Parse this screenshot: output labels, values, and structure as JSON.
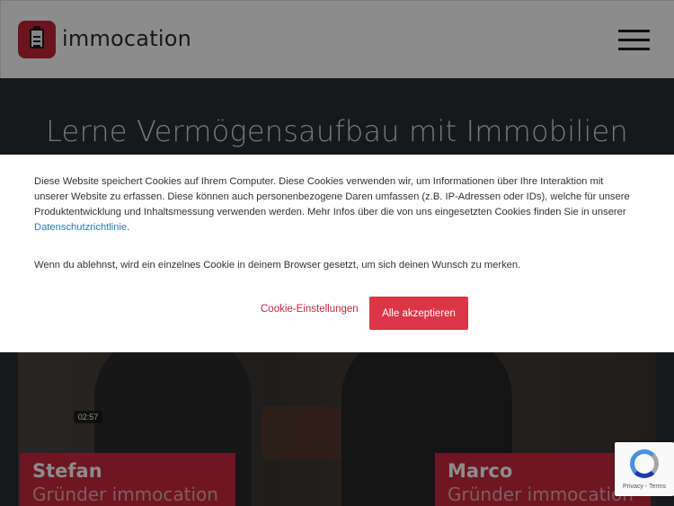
{
  "header": {
    "logo_text": "immocation",
    "menu_icon": "hamburger-icon"
  },
  "hero": {
    "title": "Lerne Vermögensaufbau mit Immobilien"
  },
  "video": {
    "person1_name": "Stefan",
    "person1_role": "Gründer immocation",
    "person2_name": "Marco",
    "person2_role": "Gründer immocation",
    "timestamp": "02:57"
  },
  "cookie": {
    "text1": "Diese Website speichert Cookies auf Ihrem Computer. Diese Cookies verwenden wir, um Informationen über Ihre Interaktion mit unserer Website zu erfassen. Diese können auch personenbezogene Daren umfassen (z.B. IP-Adressen oder IDs), welche für unsere Produktentwicklung und Inhaltsmessung verwenden werden. Mehr Infos über die von uns eingesetzten Cookies finden Sie in unserer ",
    "privacy_link": "Datenschutzrichtlinie",
    "text1_end": ".",
    "text2": "Wenn du ablehnst, wird ein einzelnes Cookie in deinem Browser gesetzt, um sich deinen Wunsch zu merken.",
    "settings_label": "Cookie-Einstellungen",
    "accept_label": "Alle akzeptieren"
  },
  "recaptcha": {
    "footer": "Privacy - Terms"
  },
  "colors": {
    "brand_red": "#c9283c",
    "accept_button": "#dc3545",
    "link_blue": "#2a7bbd"
  }
}
